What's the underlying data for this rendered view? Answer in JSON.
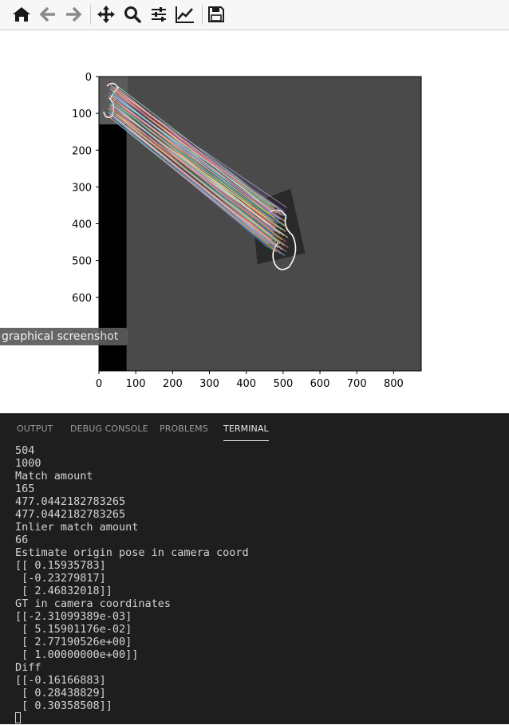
{
  "toolbar": {
    "buttons": [
      {
        "icon": "home-icon"
      },
      {
        "icon": "back-arrow-icon"
      },
      {
        "icon": "forward-arrow-icon"
      },
      {
        "icon": "pan-icon"
      },
      {
        "icon": "zoom-icon"
      },
      {
        "icon": "configure-subplots-icon"
      },
      {
        "icon": "edit-axis-icon"
      },
      {
        "icon": "save-icon"
      }
    ]
  },
  "tooltip": "graphical screenshot",
  "chart_data": {
    "type": "image",
    "xticks": [
      0,
      100,
      200,
      300,
      400,
      500,
      600,
      700,
      800
    ],
    "yticks": [
      0,
      100,
      200,
      300,
      400,
      500,
      600,
      700
    ],
    "xlim": [
      0,
      875
    ],
    "ylim": [
      800,
      0
    ],
    "grid": false,
    "colors": {
      "background": "#4a4a4a",
      "left_strip": "#000000",
      "object": "#2a2a2a",
      "match_lines": [
        "#ff6b6b",
        "#4ecdc4",
        "#ffe66d",
        "#95e1d3",
        "#f38181",
        "#aa96da",
        "#fcbad3",
        "#a8e6cf",
        "#ffd3b6",
        "#ff8b94",
        "#6c5ce7",
        "#00b894",
        "#fdcb6e",
        "#e17055",
        "#74b9ff"
      ]
    }
  },
  "panel": {
    "tabs": [
      "OUTPUT",
      "DEBUG CONSOLE",
      "PROBLEMS",
      "TERMINAL"
    ],
    "active_tab": "TERMINAL",
    "terminal_lines": [
      "504",
      "1000",
      "Match amount",
      "165",
      "477.0442182783265",
      "477.0442182783265",
      "Inlier match amount",
      "66",
      "Estimate origin pose in camera coord",
      "[[ 0.15935783]",
      " [-0.23279817]",
      " [ 2.46832018]]",
      "GT in camera coordinates",
      "[[-2.31099389e-03]",
      " [ 5.15901176e-02]",
      " [ 2.77190526e+00]",
      " [ 1.00000000e+00]]",
      "Diff",
      "[[-0.16166883]",
      " [ 0.28438829]",
      " [ 0.30358508]]"
    ]
  }
}
